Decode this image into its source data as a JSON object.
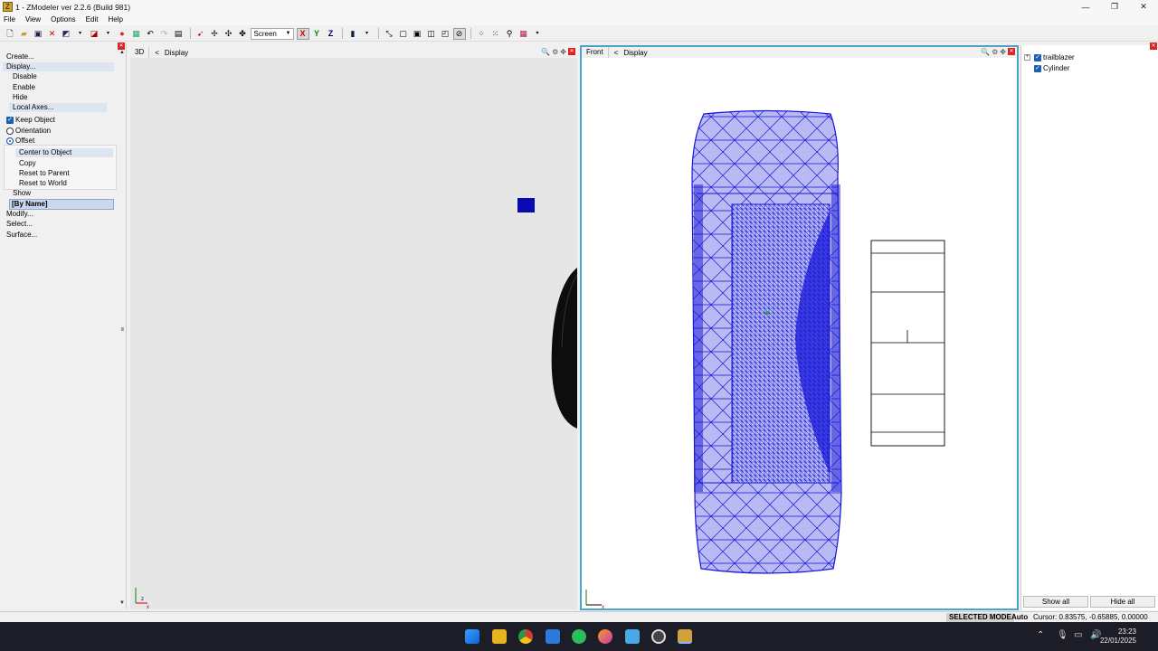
{
  "window": {
    "title": "1 - ZModeler ver 2.2.6 (Build 981)",
    "minimize": "—",
    "maximize": "❐",
    "close": "✕"
  },
  "menu": {
    "items": [
      "File",
      "View",
      "Options",
      "Edit",
      "Help"
    ]
  },
  "toolbar": {
    "mode_select": "Screen",
    "axis_x": "X",
    "axis_y": "Y",
    "axis_z": "Z"
  },
  "left_panel": {
    "create": "Create...",
    "display": "Display...",
    "disable": "Disable",
    "enable": "Enable",
    "hide": "Hide",
    "local_axes": "Local Axes...",
    "keep_object": "Keep Object",
    "orientation": "Orientation",
    "offset": "Offset",
    "center_to_object": "Center to Object",
    "copy": "Copy",
    "reset_to_parent": "Reset to Parent",
    "reset_to_world": "Reset to World",
    "show": "Show",
    "by_name": "[By Name]",
    "modify": "Modify...",
    "select": "Select...",
    "surface": "Surface..."
  },
  "viewport_3d": {
    "label": "3D",
    "nav": "<",
    "display": "Display"
  },
  "viewport_front": {
    "label": "Front",
    "nav": "<",
    "display": "Display"
  },
  "object_tree": {
    "items": [
      {
        "name": "trailblazer",
        "expander": "+",
        "checked": true
      },
      {
        "name": "Cylinder",
        "checked": true
      }
    ],
    "show_all": "Show all",
    "hide_all": "Hide all"
  },
  "status": {
    "mode": "SELECTED MODE",
    "auto": "Auto",
    "cursor": "Cursor: 0.83575, -0.65885, 0.00000"
  },
  "clock": {
    "time": "23:23",
    "date": "22/01/2025"
  },
  "colors": {
    "wire": "#1616d8",
    "fill": "#b9b9f4",
    "active_border": "#4aa3c8",
    "taskbar": "#1d1d28"
  }
}
